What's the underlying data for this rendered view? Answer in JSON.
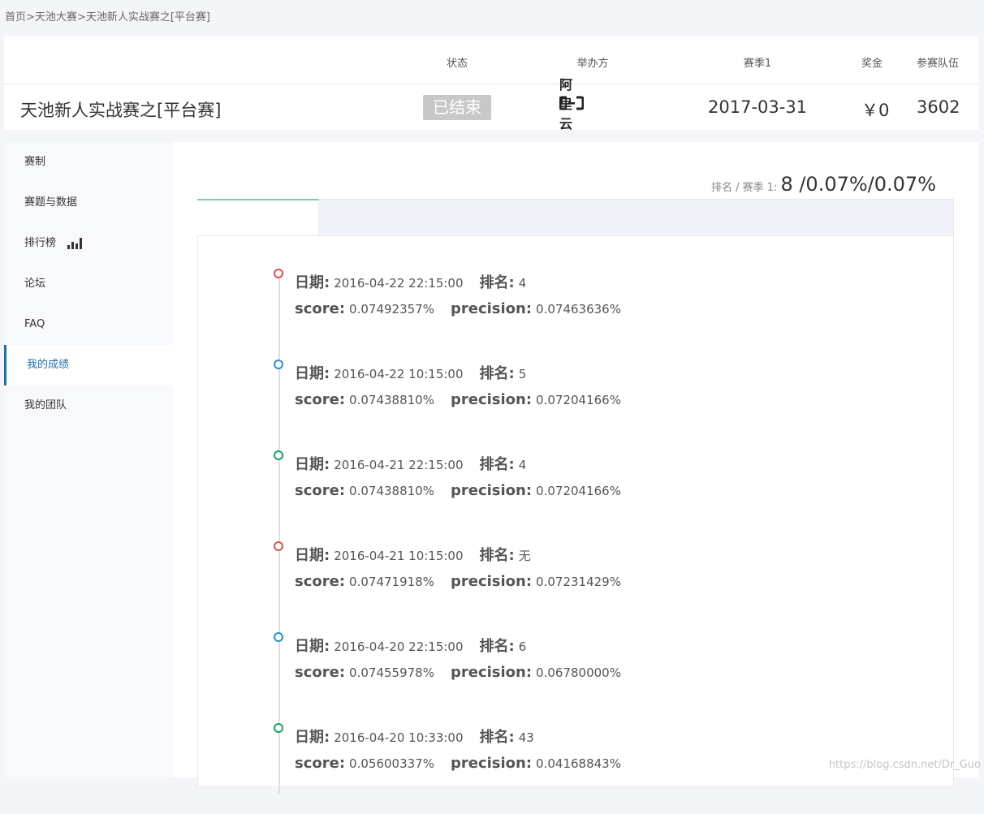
{
  "breadcrumb": {
    "items": [
      "首页",
      "天池大赛",
      "天池新人实战赛之[平台赛]"
    ],
    "separator": ">"
  },
  "info": {
    "headers": {
      "status": "状态",
      "host": "举办方",
      "season": "赛季1",
      "prize": "奖金",
      "teams": "参赛队伍"
    },
    "title": "天池新人实战赛之[平台赛]",
    "status": "已结束",
    "host_logo_text": "阿里云",
    "season_date": "2017-03-31",
    "prize": "￥0",
    "teams": "3602"
  },
  "sidebar": {
    "items": [
      {
        "label": "赛制"
      },
      {
        "label": "赛题与数据"
      },
      {
        "label": "排行榜",
        "icon": "bar-chart-icon"
      },
      {
        "label": "论坛"
      },
      {
        "label": "FAQ"
      },
      {
        "label": "我的成绩",
        "active": true
      },
      {
        "label": "我的团队"
      }
    ]
  },
  "rank": {
    "label": "排名 / 赛季 1:",
    "value": "8 /0.07%/0.07%"
  },
  "timeline": {
    "labels": {
      "date": "日期:",
      "rank": "排名:",
      "score": "score:",
      "precision": "precision:"
    },
    "entries": [
      {
        "date": "2016-04-22 22:15:00",
        "rank": "4",
        "score": "0.07492357%",
        "precision": "0.07463636%",
        "color": "#d9534f"
      },
      {
        "date": "2016-04-22 10:15:00",
        "rank": "5",
        "score": "0.07438810%",
        "precision": "0.07204166%",
        "color": "#2a8fd1"
      },
      {
        "date": "2016-04-21 22:15:00",
        "rank": "4",
        "score": "0.07438810%",
        "precision": "0.07204166%",
        "color": "#1a9e62"
      },
      {
        "date": "2016-04-21 10:15:00",
        "rank": "无",
        "score": "0.07471918%",
        "precision": "0.07231429%",
        "color": "#d9534f"
      },
      {
        "date": "2016-04-20 22:15:00",
        "rank": "6",
        "score": "0.07455978%",
        "precision": "0.06780000%",
        "color": "#2a8fd1"
      },
      {
        "date": "2016-04-20 10:33:00",
        "rank": "43",
        "score": "0.05600337%",
        "precision": "0.04168843%",
        "color": "#1a9e62"
      }
    ]
  },
  "watermark": "https://blog.csdn.net/Dr_Guo"
}
